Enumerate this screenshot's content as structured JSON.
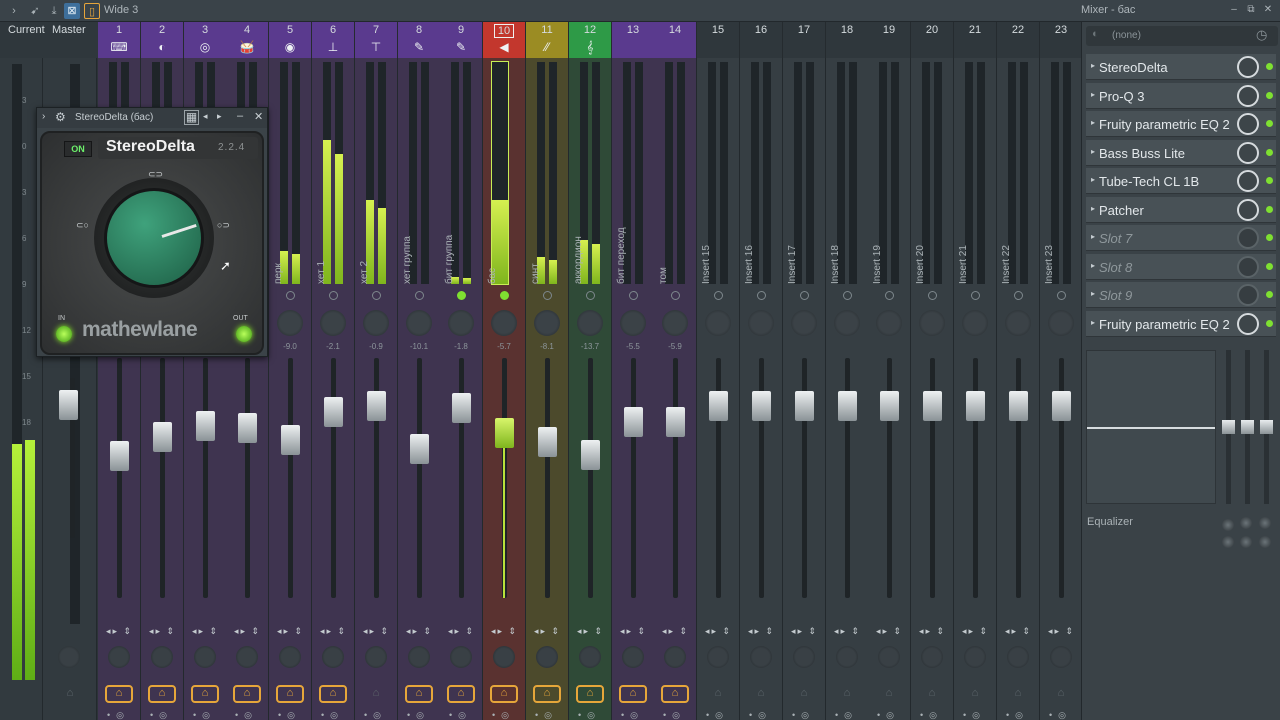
{
  "toolbar": {
    "layout_name": "Wide 3",
    "mixer_title": "Mixer - бас"
  },
  "header": {
    "current_label": "Current",
    "master_label": "Master"
  },
  "channels": [
    {
      "num": "1",
      "name": "",
      "icon": "⌨",
      "color": "#5a3a8e",
      "meter": 0,
      "pan": "",
      "fader": 0.55
    },
    {
      "num": "2",
      "name": "",
      "icon": "◐",
      "color": "#5a3a8e",
      "meter": 0,
      "pan": "",
      "fader": 0.72
    },
    {
      "num": "3",
      "name": "",
      "icon": "◎",
      "color": "#5a3a8e",
      "meter": 0,
      "pan": "",
      "fader": 0.82
    },
    {
      "num": "4",
      "name": "",
      "icon": "🥁",
      "color": "#5a3a8e",
      "meter": 0,
      "pan": "",
      "fader": 0.8
    },
    {
      "num": "5",
      "name": "перк",
      "icon": "◉",
      "color": "#5a3a8e",
      "meter": 0.15,
      "pan": "-9.0",
      "fader": 0.7
    },
    {
      "num": "6",
      "name": "хет 1",
      "icon": "⊥",
      "color": "#5a3a8e",
      "meter": 0.65,
      "pan": "-2.1",
      "fader": 0.95
    },
    {
      "num": "7",
      "name": "хет 2",
      "icon": "⊤",
      "color": "#5a3a8e",
      "meter": 0.38,
      "pan": "-0.9",
      "fader": 1.0
    },
    {
      "num": "8",
      "name": "хет группа",
      "icon": "✎",
      "color": "#5a3a8e",
      "meter": 0,
      "pan": "-10.1",
      "fader": 0.62
    },
    {
      "num": "9",
      "name": "бит группа",
      "icon": "✎",
      "color": "#5a3a8e",
      "meter": 0.03,
      "pan": "-1.8",
      "fader": 0.98
    },
    {
      "num": "10",
      "name": "бас",
      "icon": "◀",
      "color": "#a33b2c",
      "meter": 0.38,
      "pan": "-5.7",
      "fader": 0.76
    },
    {
      "num": "11",
      "name": "синт",
      "icon": "⁄⁄",
      "color": "#8a7a1e",
      "meter": 0.12,
      "pan": "-8.1",
      "fader": 0.68
    },
    {
      "num": "12",
      "name": "аккордион",
      "icon": "𝄞",
      "color": "#2f8a3e",
      "meter": 0.2,
      "pan": "-13.7",
      "fader": 0.56
    },
    {
      "num": "13",
      "name": "бит переход",
      "icon": "",
      "color": "#5a3a8e",
      "meter": 0,
      "pan": "-5.5",
      "fader": 0.86
    },
    {
      "num": "14",
      "name": "том",
      "icon": "",
      "color": "#5a3a8e",
      "meter": 0,
      "pan": "-5.9",
      "fader": 0.86
    },
    {
      "num": "15",
      "name": "Insert 15",
      "icon": "",
      "color": "",
      "meter": 0,
      "pan": "",
      "fader": 1.0
    },
    {
      "num": "16",
      "name": "Insert 16",
      "icon": "",
      "color": "",
      "meter": 0,
      "pan": "",
      "fader": 1.0
    },
    {
      "num": "17",
      "name": "Insert 17",
      "icon": "",
      "color": "",
      "meter": 0,
      "pan": "",
      "fader": 1.0
    },
    {
      "num": "18",
      "name": "Insert 18",
      "icon": "",
      "color": "",
      "meter": 0,
      "pan": "",
      "fader": 1.0
    },
    {
      "num": "19",
      "name": "Insert 19",
      "icon": "",
      "color": "",
      "meter": 0,
      "pan": "",
      "fader": 1.0
    },
    {
      "num": "20",
      "name": "Insert 20",
      "icon": "",
      "color": "",
      "meter": 0,
      "pan": "",
      "fader": 1.0
    },
    {
      "num": "21",
      "name": "Insert 21",
      "icon": "",
      "color": "",
      "meter": 0,
      "pan": "",
      "fader": 1.0
    },
    {
      "num": "22",
      "name": "Insert 22",
      "icon": "",
      "color": "",
      "meter": 0,
      "pan": "",
      "fader": 1.0
    },
    {
      "num": "23",
      "name": "Insert 23",
      "icon": "",
      "color": "",
      "meter": 0,
      "pan": "",
      "fader": 1.0
    }
  ],
  "master": {
    "meter": 0.9,
    "fader": 1.0
  },
  "db_scale": [
    "3",
    "0",
    "3",
    "6",
    "9",
    "12",
    "15",
    "18"
  ],
  "plugin": {
    "window_title": "StereoDelta (бас)",
    "on_label": "ON",
    "name": "StereoDelta",
    "version": "2.2.4",
    "logo": "mathewlane",
    "in_label": "IN",
    "out_label": "OUT"
  },
  "right_panel": {
    "preset": "(none)",
    "slots": [
      {
        "label": "StereoDelta",
        "empty": false
      },
      {
        "label": "Pro-Q 3",
        "empty": false
      },
      {
        "label": "Fruity parametric EQ 2",
        "empty": false
      },
      {
        "label": "Bass Buss Lite",
        "empty": false
      },
      {
        "label": "Tube-Tech CL 1B",
        "empty": false
      },
      {
        "label": "Patcher",
        "empty": false
      },
      {
        "label": "Slot 7",
        "empty": true
      },
      {
        "label": "Slot 8",
        "empty": true
      },
      {
        "label": "Slot 9",
        "empty": true
      },
      {
        "label": "Fruity parametric EQ 2",
        "empty": false
      }
    ],
    "eq_label": "Equalizer"
  },
  "colors": {
    "accent": "#7fe031",
    "route": "#e6a63a",
    "selected_strip": "#a33b2c"
  }
}
